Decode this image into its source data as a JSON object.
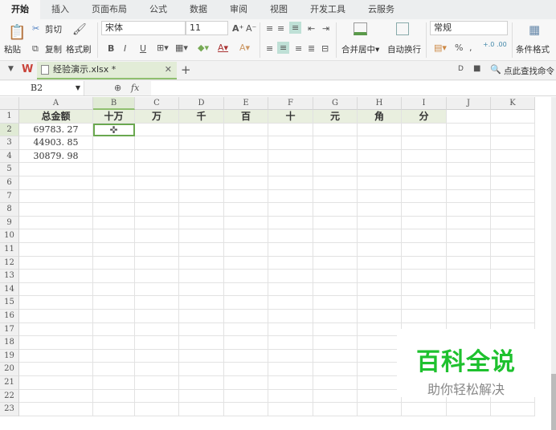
{
  "tabs": [
    "开始",
    "插入",
    "页面布局",
    "公式",
    "数据",
    "审阅",
    "视图",
    "开发工具",
    "云服务"
  ],
  "active_tab": 0,
  "ribbon": {
    "paste": "粘贴",
    "cut": "剪切",
    "copy": "复制",
    "format_painter": "格式刷",
    "font": "宋体",
    "font_size": "11",
    "merge": "合并居中",
    "wrap": "自动换行",
    "number_format": "常规",
    "conditional": "条件格式"
  },
  "doc_tab": {
    "title": "经验演示.xlsx *"
  },
  "search": "点此查找命令",
  "namebox": "B2",
  "fx": "fx",
  "columns": [
    "A",
    "B",
    "C",
    "D",
    "E",
    "F",
    "G",
    "H",
    "I",
    "J",
    "K"
  ],
  "row_count": 23,
  "cells": {
    "header": [
      "总金额",
      "十万",
      "万",
      "千",
      "百",
      "十",
      "元",
      "角",
      "分"
    ],
    "amounts": [
      "69783. 27",
      "44903. 85",
      "30879. 98"
    ]
  },
  "selected_cell": "B2",
  "watermark": {
    "title": "百科全说",
    "subtitle": "助你轻松解决",
    "color": "#1ec12e"
  }
}
